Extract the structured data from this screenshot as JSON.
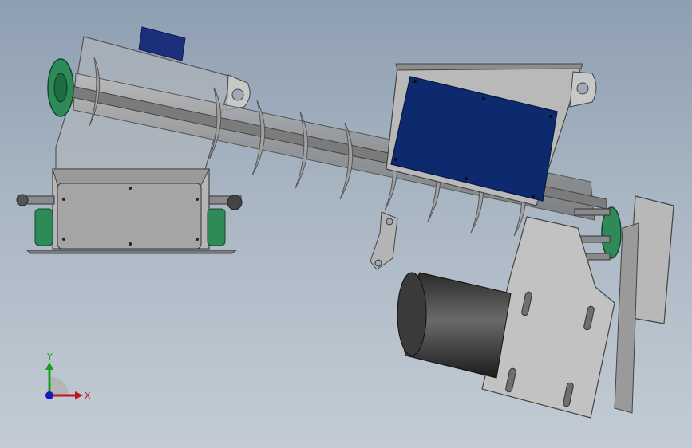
{
  "viewport": {
    "background_top": "#8e9fb2",
    "background_bottom": "#c3ccd5"
  },
  "model": {
    "body_color": "#a8a8a8",
    "flange_color": "#2e8b57",
    "panel_color": "#0d2a6e",
    "motor_color": "#3c3c3c"
  },
  "triad": {
    "x_label": "X",
    "y_label": "Y",
    "x_color": "#c01818",
    "y_color": "#18a018",
    "z_color": "#1818c0"
  }
}
